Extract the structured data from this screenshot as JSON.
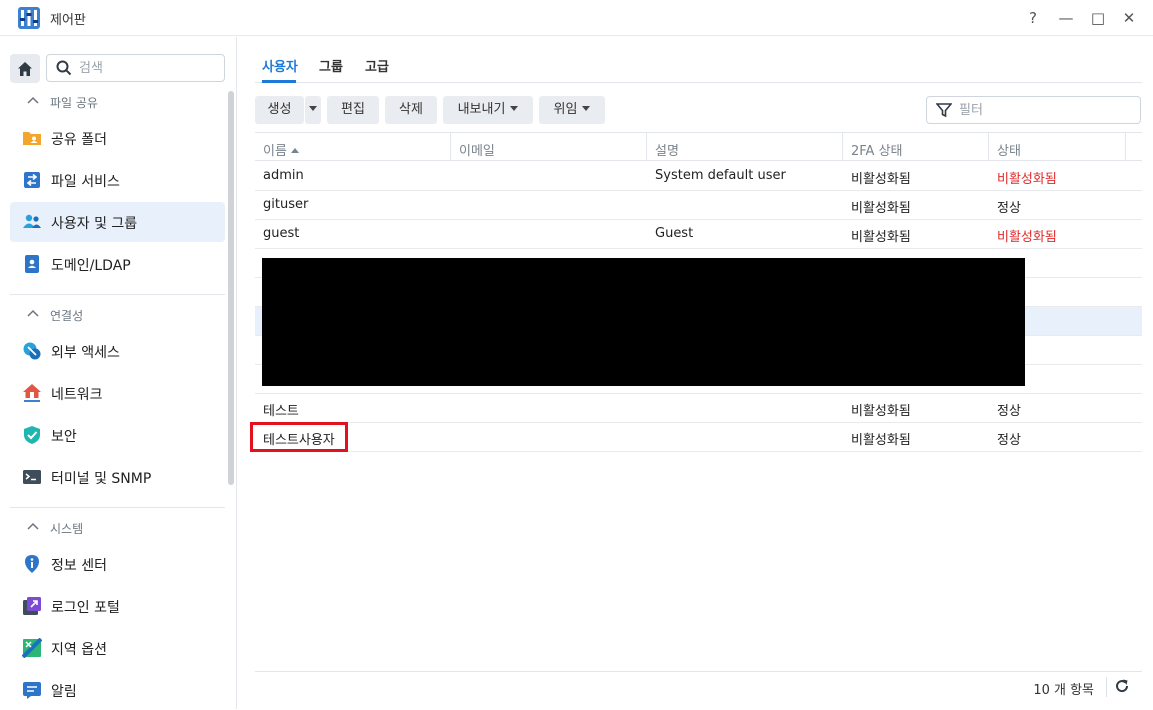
{
  "window": {
    "title": "제어판",
    "controls": [
      "?",
      "—",
      "□",
      "✕"
    ]
  },
  "sidebar": {
    "search_placeholder": "검색",
    "sections": [
      {
        "label": "파일 공유",
        "items": [
          {
            "label": "공유 폴더",
            "icon": "shared-folder-icon"
          },
          {
            "label": "파일 서비스",
            "icon": "file-services-icon"
          },
          {
            "label": "사용자 및 그룹",
            "icon": "users-groups-icon",
            "active": true
          },
          {
            "label": "도메인/LDAP",
            "icon": "domain-ldap-icon"
          }
        ]
      },
      {
        "label": "연결성",
        "items": [
          {
            "label": "외부 액세스",
            "icon": "external-access-icon"
          },
          {
            "label": "네트워크",
            "icon": "network-icon"
          },
          {
            "label": "보안",
            "icon": "security-shield-icon"
          },
          {
            "label": "터미널 및 SNMP",
            "icon": "terminal-icon"
          }
        ]
      },
      {
        "label": "시스템",
        "items": [
          {
            "label": "정보 센터",
            "icon": "info-center-icon"
          },
          {
            "label": "로그인 포털",
            "icon": "login-portal-icon"
          },
          {
            "label": "지역 옵션",
            "icon": "regional-options-icon"
          },
          {
            "label": "알림",
            "icon": "notification-icon"
          }
        ]
      }
    ]
  },
  "tabs": [
    "사용자",
    "그룹",
    "고급"
  ],
  "toolbar": {
    "create": "생성",
    "edit": "편집",
    "delete": "삭제",
    "export": "내보내기",
    "delegate": "위임",
    "filter_placeholder": "필터"
  },
  "table": {
    "headers": [
      "이름",
      "이메일",
      "설명",
      "2FA 상태",
      "상태"
    ],
    "rows": [
      {
        "name": "admin",
        "email": "",
        "description": "System default user",
        "twofa": "비활성화됨",
        "status": "비활성화됨",
        "status_color": "#e02a2a"
      },
      {
        "name": "gituser",
        "email": "",
        "description": "",
        "twofa": "비활성화됨",
        "status": "정상",
        "status_color": "#222222"
      },
      {
        "name": "guest",
        "email": "",
        "description": "Guest",
        "twofa": "비활성화됨",
        "status": "비활성화됨",
        "status_color": "#e02a2a"
      },
      {
        "name": "테스트",
        "email": "",
        "description": "",
        "twofa": "비활성화됨",
        "status": "정상",
        "status_color": "#222222"
      },
      {
        "name": "테스트사용자",
        "email": "",
        "description": "",
        "twofa": "비활성화됨",
        "status": "정상",
        "status_color": "#222222"
      }
    ]
  },
  "footer": {
    "count": "10 개 항목"
  },
  "colors": {
    "accent": "#1e7ad8",
    "disabled_status": "#e02a2a",
    "highlight_box": "#e3101e"
  }
}
